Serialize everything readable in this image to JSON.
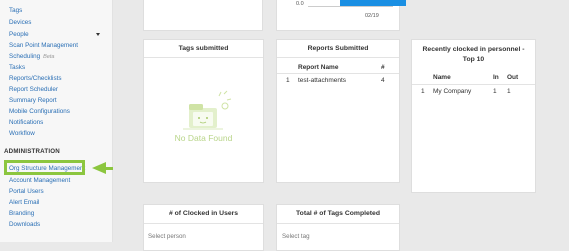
{
  "sidebar": {
    "items": [
      {
        "label": "Tags"
      },
      {
        "label": "Devices"
      },
      {
        "label": "People"
      },
      {
        "label": "Scan Point Management"
      },
      {
        "label": "Scheduling",
        "badge": "Beta"
      },
      {
        "label": "Tasks"
      },
      {
        "label": "Reports/Checklists"
      },
      {
        "label": "Report Scheduler"
      },
      {
        "label": "Summary Report"
      },
      {
        "label": "Mobile Configurations"
      },
      {
        "label": "Notifications"
      },
      {
        "label": "Workflow"
      }
    ],
    "admin_heading": "ADMINISTRATION",
    "admin_items": [
      {
        "label": "Org Structure Management"
      },
      {
        "label": "Account Management"
      },
      {
        "label": "Portal Users"
      },
      {
        "label": "Alert Email"
      },
      {
        "label": "Branding"
      },
      {
        "label": "Downloads"
      }
    ]
  },
  "top_chart": {
    "y_tick": "0.0",
    "x_tick": "02/19"
  },
  "cards": {
    "tags_submitted": {
      "title": "Tags submitted",
      "empty_text": "No Data Found"
    },
    "reports_submitted": {
      "title": "Reports Submitted",
      "columns": [
        "Report Name",
        "#"
      ],
      "rows": [
        {
          "idx": "1",
          "name": "test-attachments",
          "count": "4"
        }
      ]
    },
    "recently_clocked": {
      "title": "Recently clocked in personnel - Top 10",
      "columns": [
        "Name",
        "In",
        "Out"
      ],
      "rows": [
        {
          "idx": "1",
          "name": "My Company",
          "in": "1",
          "out": "1"
        }
      ]
    },
    "clocked_in_users": {
      "title": "# of Clocked in Users",
      "placeholder": "Select person"
    },
    "tags_completed": {
      "title": "Total # of Tags Completed",
      "placeholder": "Select tag"
    }
  },
  "colors": {
    "accent_blue": "#1a8fe3",
    "callout_green": "#8cc63f",
    "link_blue": "#2a6fb5"
  }
}
